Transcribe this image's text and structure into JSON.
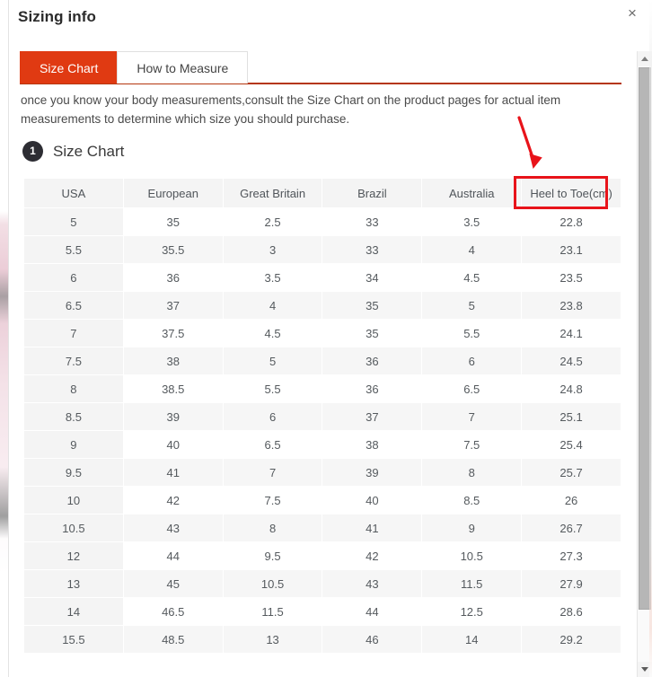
{
  "dialog": {
    "title": "Sizing info",
    "close_label": "×",
    "close_icon": "close-icon"
  },
  "tabs": [
    {
      "label": "Size Chart",
      "active": true
    },
    {
      "label": "How to Measure",
      "active": false
    }
  ],
  "description": "once you know your body measurements,consult the Size Chart on the product pages for actual item measurements to determine which size you should purchase.",
  "section": {
    "badge": "1",
    "title": "Size Chart"
  },
  "annotation": {
    "arrow_color": "#e8131a",
    "highlight_color": "#e8131a",
    "highlighted_column": "Heel to Toe(cm)"
  },
  "colors": {
    "tab_active_bg": "#e03a12",
    "tab_underline": "#b5360f",
    "badge_bg": "#2d2d33",
    "header_bg": "#f4f4f4",
    "stripe_bg": "#f6f6f6"
  },
  "scrollbar": {
    "up_icon": "triangle-up-icon",
    "down_icon": "triangle-down-icon"
  },
  "chart_data": {
    "type": "table",
    "title": "Size Chart",
    "categories": [
      "USA",
      "European",
      "Great Britain",
      "Brazil",
      "Australia",
      "Heel to Toe(cm)"
    ],
    "rows": [
      [
        "5",
        "35",
        "2.5",
        "33",
        "3.5",
        "22.8"
      ],
      [
        "5.5",
        "35.5",
        "3",
        "33",
        "4",
        "23.1"
      ],
      [
        "6",
        "36",
        "3.5",
        "34",
        "4.5",
        "23.5"
      ],
      [
        "6.5",
        "37",
        "4",
        "35",
        "5",
        "23.8"
      ],
      [
        "7",
        "37.5",
        "4.5",
        "35",
        "5.5",
        "24.1"
      ],
      [
        "7.5",
        "38",
        "5",
        "36",
        "6",
        "24.5"
      ],
      [
        "8",
        "38.5",
        "5.5",
        "36",
        "6.5",
        "24.8"
      ],
      [
        "8.5",
        "39",
        "6",
        "37",
        "7",
        "25.1"
      ],
      [
        "9",
        "40",
        "6.5",
        "38",
        "7.5",
        "25.4"
      ],
      [
        "9.5",
        "41",
        "7",
        "39",
        "8",
        "25.7"
      ],
      [
        "10",
        "42",
        "7.5",
        "40",
        "8.5",
        "26"
      ],
      [
        "10.5",
        "43",
        "8",
        "41",
        "9",
        "26.7"
      ],
      [
        "12",
        "44",
        "9.5",
        "42",
        "10.5",
        "27.3"
      ],
      [
        "13",
        "45",
        "10.5",
        "43",
        "11.5",
        "27.9"
      ],
      [
        "14",
        "46.5",
        "11.5",
        "44",
        "12.5",
        "28.6"
      ],
      [
        "15.5",
        "48.5",
        "13",
        "46",
        "14",
        "29.2"
      ]
    ]
  }
}
